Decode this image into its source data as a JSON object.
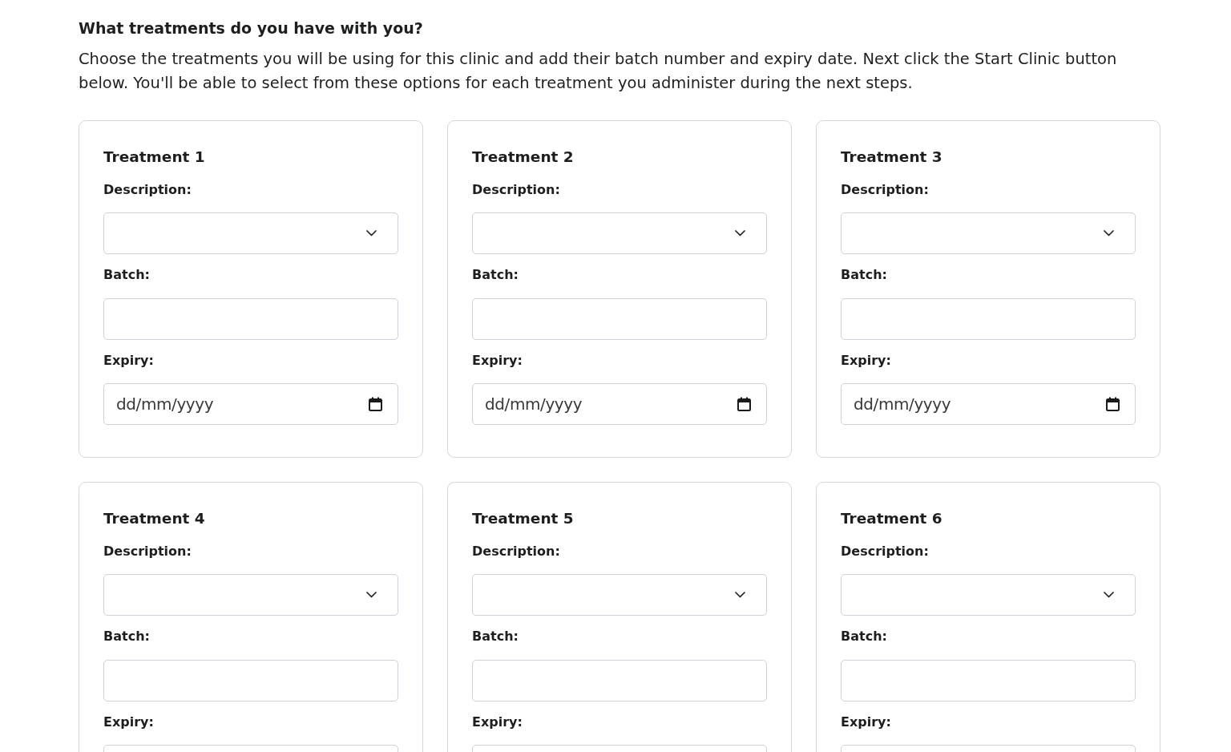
{
  "heading": "What treatments do you have with you?",
  "intro": "Choose the treatments you will be using for this clinic and add their batch number and expiry date. Next click the Start Clinic button below. You'll be able to select from these options for each treatment you administer during the next steps.",
  "treatments": [
    {
      "title": "Treatment 1",
      "description": {
        "label": "Description:"
      },
      "batch": {
        "label": "Batch:"
      },
      "expiry": {
        "label": "Expiry:",
        "placeholder": "dd/mm/yyyy"
      }
    },
    {
      "title": "Treatment 2",
      "description": {
        "label": "Description:"
      },
      "batch": {
        "label": "Batch:"
      },
      "expiry": {
        "label": "Expiry:",
        "placeholder": "dd/mm/yyyy"
      }
    },
    {
      "title": "Treatment 3",
      "description": {
        "label": "Description:"
      },
      "batch": {
        "label": "Batch:"
      },
      "expiry": {
        "label": "Expiry:",
        "placeholder": "dd/mm/yyyy"
      }
    },
    {
      "title": "Treatment 4",
      "description": {
        "label": "Description:"
      },
      "batch": {
        "label": "Batch:"
      },
      "expiry": {
        "label": "Expiry:"
      }
    },
    {
      "title": "Treatment 5",
      "description": {
        "label": "Description:"
      },
      "batch": {
        "label": "Batch:"
      },
      "expiry": {
        "label": "Expiry:"
      }
    },
    {
      "title": "Treatment 6",
      "description": {
        "label": "Description:"
      },
      "batch": {
        "label": "Batch:"
      },
      "expiry": {
        "label": "Expiry:"
      }
    }
  ]
}
